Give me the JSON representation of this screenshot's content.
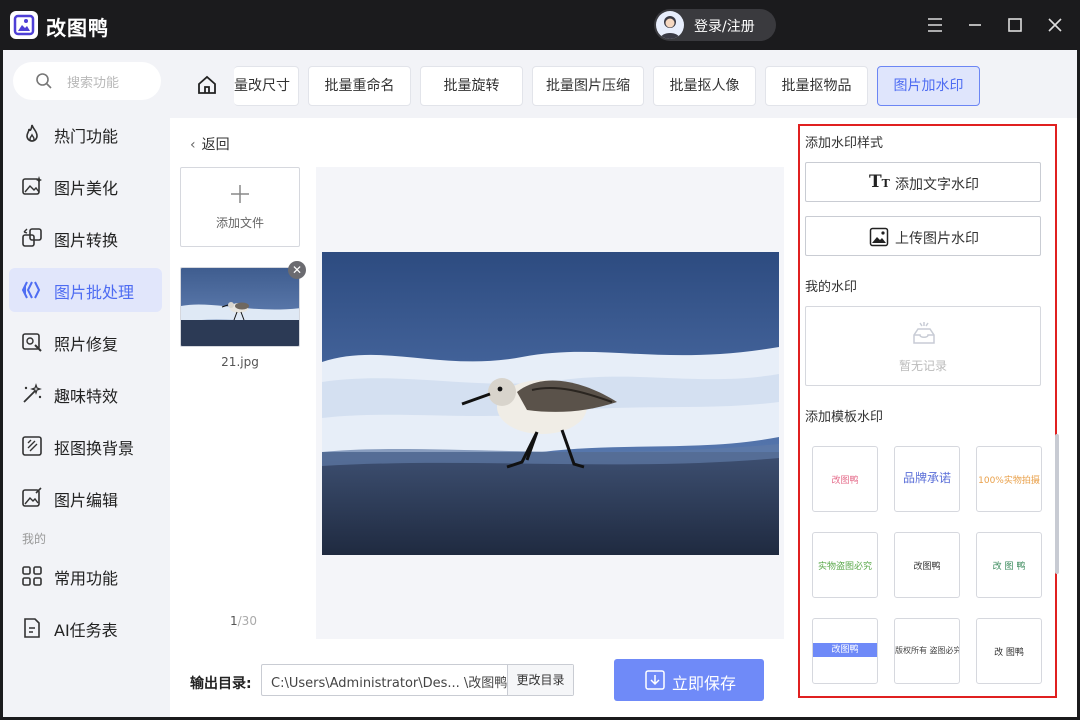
{
  "app": {
    "title": "改图鸭",
    "login": "登录/注册"
  },
  "sidebar": {
    "search_placeholder": "搜索功能",
    "items": [
      {
        "label": "热门功能",
        "icon": "flame-icon"
      },
      {
        "label": "图片美化",
        "icon": "image-sparkle-icon"
      },
      {
        "label": "图片转换",
        "icon": "convert-icon"
      },
      {
        "label": "图片批处理",
        "icon": "batch-icon",
        "active": true
      },
      {
        "label": "照片修复",
        "icon": "repair-icon"
      },
      {
        "label": "趣味特效",
        "icon": "magic-wand-icon"
      },
      {
        "label": "抠图换背景",
        "icon": "cutout-icon"
      },
      {
        "label": "图片编辑",
        "icon": "edit-image-icon"
      }
    ],
    "section_mine": "我的",
    "mine_items": [
      {
        "label": "常用功能",
        "icon": "grid-icon"
      },
      {
        "label": "AI任务表",
        "icon": "task-list-icon"
      }
    ]
  },
  "toolbar": {
    "tabs": [
      "量改尺寸",
      "批量重命名",
      "批量旋转",
      "批量图片压缩",
      "批量抠人像",
      "批量抠物品",
      "图片加水印"
    ],
    "active_tab": "图片加水印"
  },
  "workspace": {
    "back": "返回",
    "add_file": "添加文件",
    "file_name": "21.jpg",
    "page_current": "1",
    "page_total": "/30"
  },
  "output": {
    "label": "输出目录:",
    "path": "C:\\Users\\Administrator\\Des... \\改图鸭",
    "change_dir": "更改目录",
    "save": "立即保存"
  },
  "watermark_panel": {
    "style_heading": "添加水印样式",
    "add_text": "添加文字水印",
    "upload_image": "上传图片水印",
    "mine_heading": "我的水印",
    "empty": "暂无记录",
    "template_heading": "添加模板水印",
    "templates": [
      "改图鸭",
      "品牌承诺",
      "100%实物拍摄",
      "实物盗图必究",
      "改图鸭",
      "改 图 鸭",
      "改图鸭",
      "版权所有 盗图必究",
      "改 图鸭"
    ]
  },
  "colors": {
    "accent": "#4e6cf2",
    "save_button": "#6f8af8",
    "highlight_border": "#e02020"
  }
}
